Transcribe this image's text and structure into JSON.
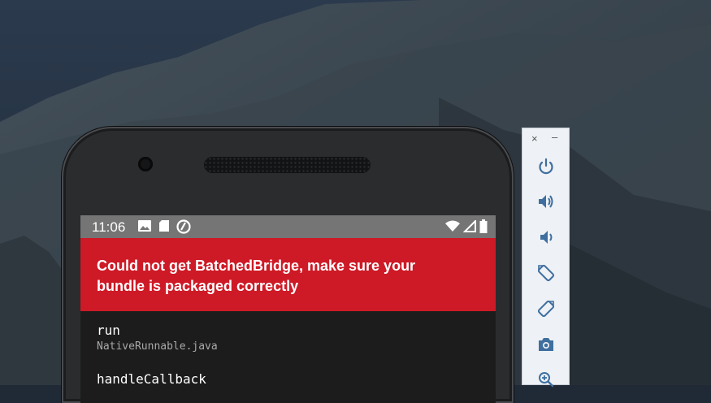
{
  "status_bar": {
    "time": "11:06"
  },
  "error": {
    "message": "Could not get BatchedBridge, make sure your bundle is packaged correctly"
  },
  "stack_frames": [
    {
      "method": "run",
      "file": "NativeRunnable.java"
    },
    {
      "method": "handleCallback",
      "file": ""
    }
  ],
  "toolbar": {
    "close_label": "×",
    "minimize_label": "–",
    "buttons": [
      "power-icon",
      "volume-up-icon",
      "volume-down-icon",
      "rotate-left-icon",
      "rotate-right-icon",
      "camera-icon",
      "zoom-in-icon"
    ]
  },
  "colors": {
    "error_red": "#ce1a26",
    "status_bar_gray": "#757575",
    "toolbar_icon_blue": "#3f6f9e"
  }
}
